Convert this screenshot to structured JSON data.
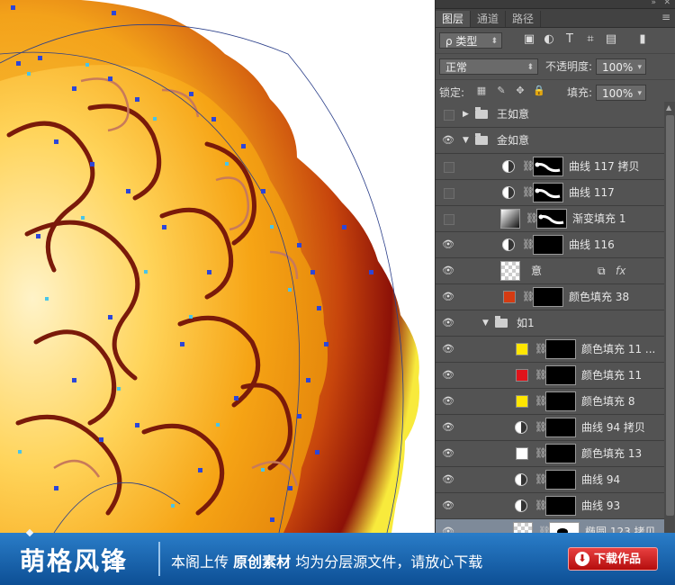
{
  "panel": {
    "tabs": [
      "图层",
      "通道",
      "路径"
    ],
    "menu_icon": "panel-menu-icon",
    "filter": {
      "label": "ρ 类型"
    },
    "blend_mode": "正常",
    "opacity_label": "不透明度:",
    "opacity_value": "100%",
    "lock_label": "锁定:",
    "fill_label": "填充:",
    "fill_value": "100%",
    "layers": [
      {
        "name": "王如意",
        "type": "group",
        "indent": 0,
        "visible": false,
        "expanded": false
      },
      {
        "name": "金如意",
        "type": "group",
        "indent": 0,
        "visible": true,
        "expanded": true
      },
      {
        "name": "曲线 117 拷贝",
        "type": "adjust",
        "indent": 1,
        "visible": false,
        "mask": "curve"
      },
      {
        "name": "曲线 117",
        "type": "adjust",
        "indent": 1,
        "visible": false,
        "mask": "curve"
      },
      {
        "name": "渐变填充 1",
        "type": "gradient",
        "indent": 1,
        "visible": false,
        "mask": "curve"
      },
      {
        "name": "曲线 116",
        "type": "adjust",
        "indent": 1,
        "visible": true,
        "mask": "black"
      },
      {
        "name": "意",
        "type": "smart",
        "indent": 1,
        "visible": true,
        "fx": "fx"
      },
      {
        "name": "颜色填充 38",
        "type": "fill",
        "indent": 1,
        "visible": true,
        "color": "#d53b12",
        "mask": "black"
      },
      {
        "name": "如1",
        "type": "group",
        "indent": 1,
        "visible": true,
        "expanded": true
      },
      {
        "name": "颜色填充 11 ...",
        "type": "fill",
        "indent": 2,
        "visible": true,
        "color": "#ffe600",
        "mask": "black"
      },
      {
        "name": "颜色填充 11",
        "type": "fill",
        "indent": 2,
        "visible": true,
        "color": "#e0141b",
        "mask": "black"
      },
      {
        "name": "颜色填充 8",
        "type": "fill",
        "indent": 2,
        "visible": true,
        "color": "#ffe600",
        "mask": "black"
      },
      {
        "name": "曲线 94 拷贝",
        "type": "adjust",
        "indent": 2,
        "visible": true,
        "mask": "black"
      },
      {
        "name": "颜色填充 13",
        "type": "fill",
        "indent": 2,
        "visible": true,
        "color": "#ffffff",
        "mask": "black"
      },
      {
        "name": "曲线 94",
        "type": "adjust",
        "indent": 2,
        "visible": true,
        "mask": "black"
      },
      {
        "name": "曲线 93",
        "type": "adjust",
        "indent": 2,
        "visible": true,
        "mask": "black"
      },
      {
        "name": "椭圆 123 拷贝",
        "type": "shape",
        "indent": 2,
        "visible": true,
        "mask": "white",
        "selected": true
      }
    ]
  },
  "banner": {
    "logo": "萌格风锋",
    "message_prefix": "本阁上传 ",
    "message_bold": "原创素材",
    "message_suffix": " 均为分层源文件，请放心下载",
    "download_label": "下载作品"
  }
}
